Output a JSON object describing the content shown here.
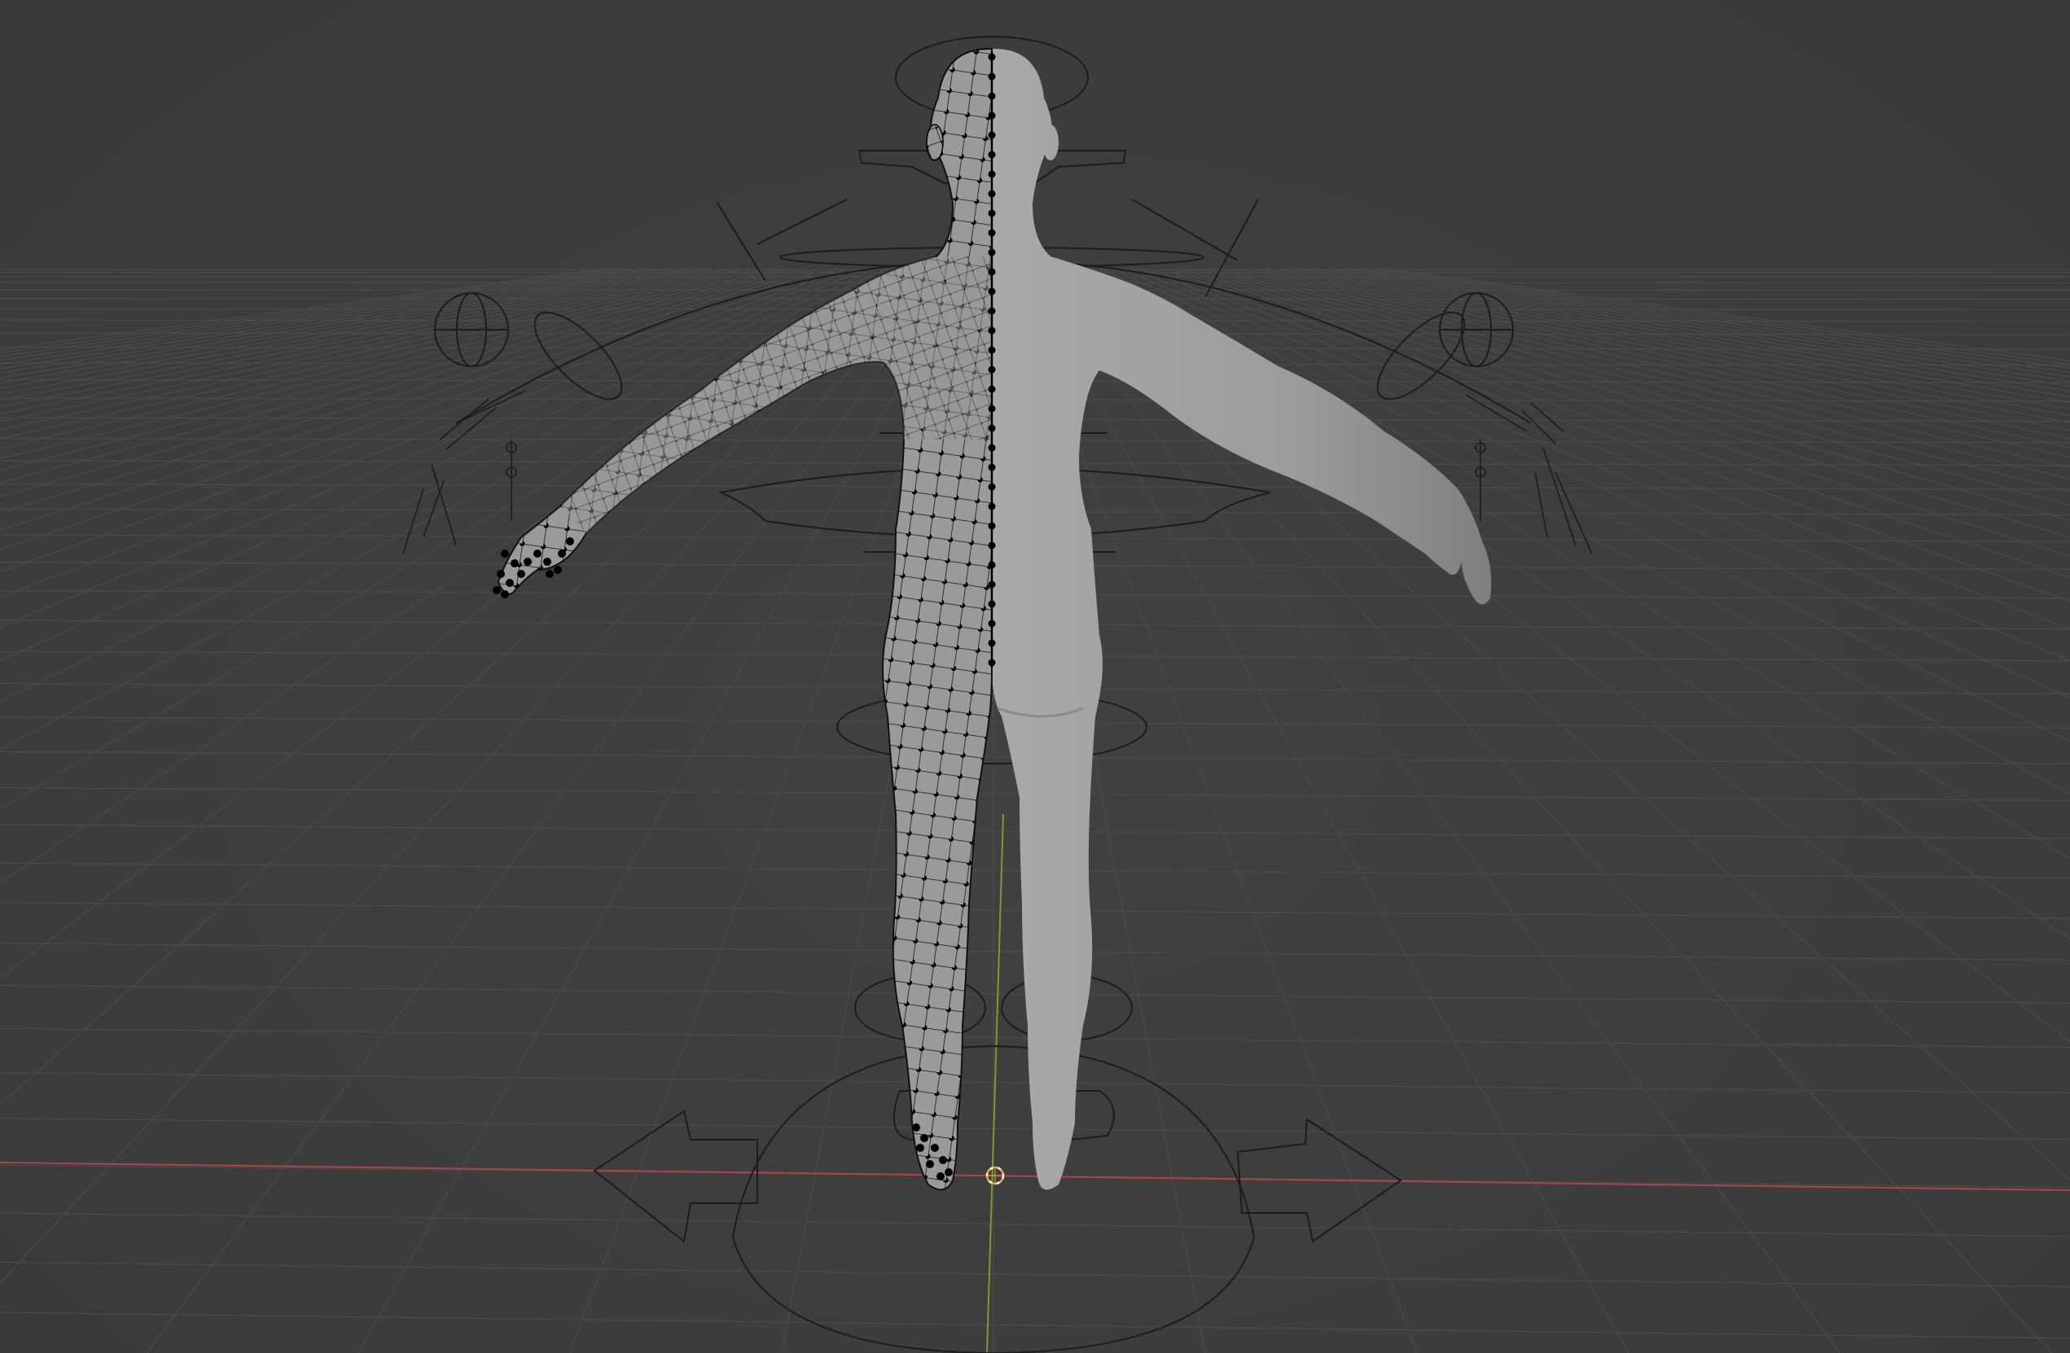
{
  "app": {
    "name": "3D viewport",
    "mode": "edit"
  },
  "viewport": {
    "background_color": "#3d3d3d",
    "grid_color": "#4b4b4b",
    "x_axis_color": "#b0424f",
    "y_axis_color": "#7e9a2e",
    "cursor_color": "#e8a34a"
  },
  "scene": {
    "mesh_left_half": "wireframe",
    "mesh_right_half": "solid",
    "mesh_color": "#9e9e9e",
    "rig_color": "#1c1c1c",
    "wire_color": "#111111",
    "vertex_color": "#000000"
  },
  "icons": {
    "cursor": "3d-cursor-icon",
    "origin": "origin-icon"
  }
}
